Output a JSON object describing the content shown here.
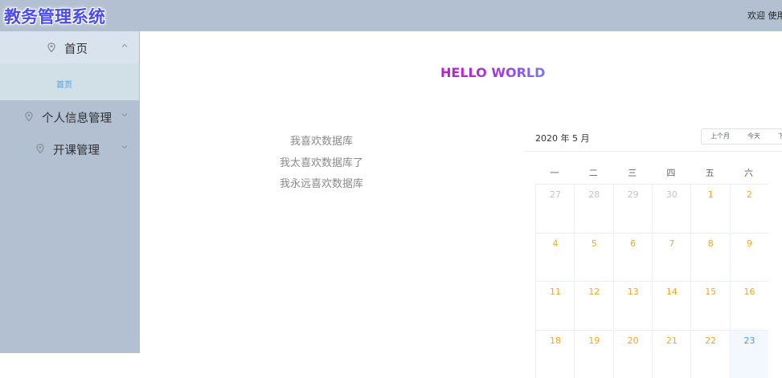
{
  "header": {
    "logo": "教务管理系统",
    "welcome": "欢迎 使用"
  },
  "sidebar": {
    "items": [
      {
        "label": "首页",
        "icon": "location-pin-icon",
        "expanded": true
      },
      {
        "label": "个人信息管理",
        "icon": "location-pin-icon",
        "expanded": false
      },
      {
        "label": "开课管理",
        "icon": "location-pin-icon",
        "expanded": false
      }
    ],
    "submenu": {
      "label": "首页"
    }
  },
  "main": {
    "hello": "HELLO WORLD",
    "quotes": [
      "我喜欢数据库",
      "我太喜欢数据库了",
      "我永远喜欢数据库"
    ]
  },
  "calendar": {
    "title": "2020 年 5 月",
    "buttons": {
      "prev": "上个月",
      "today": "今天",
      "next": "下"
    },
    "weekdays": [
      "一",
      "二",
      "三",
      "四",
      "五",
      "六"
    ],
    "weeks": [
      [
        {
          "d": "27",
          "t": "prev"
        },
        {
          "d": "28",
          "t": "prev"
        },
        {
          "d": "29",
          "t": "prev"
        },
        {
          "d": "30",
          "t": "prev"
        },
        {
          "d": "1",
          "t": "curr"
        },
        {
          "d": "2",
          "t": "curr"
        }
      ],
      [
        {
          "d": "4",
          "t": "curr"
        },
        {
          "d": "5",
          "t": "curr"
        },
        {
          "d": "6",
          "t": "curr"
        },
        {
          "d": "7",
          "t": "curr"
        },
        {
          "d": "8",
          "t": "curr"
        },
        {
          "d": "9",
          "t": "curr"
        }
      ],
      [
        {
          "d": "11",
          "t": "curr"
        },
        {
          "d": "12",
          "t": "curr"
        },
        {
          "d": "13",
          "t": "curr"
        },
        {
          "d": "14",
          "t": "curr"
        },
        {
          "d": "15",
          "t": "curr"
        },
        {
          "d": "16",
          "t": "curr"
        }
      ],
      [
        {
          "d": "18",
          "t": "curr"
        },
        {
          "d": "19",
          "t": "curr"
        },
        {
          "d": "20",
          "t": "curr"
        },
        {
          "d": "21",
          "t": "curr"
        },
        {
          "d": "22",
          "t": "curr"
        },
        {
          "d": "23",
          "t": "today"
        }
      ]
    ]
  },
  "colors": {
    "header_bg": "#b3c0d1",
    "logo": "#4b4cf0",
    "active_link": "#409eff",
    "date_current": "#f5a623",
    "date_other": "#c0c4cc"
  }
}
